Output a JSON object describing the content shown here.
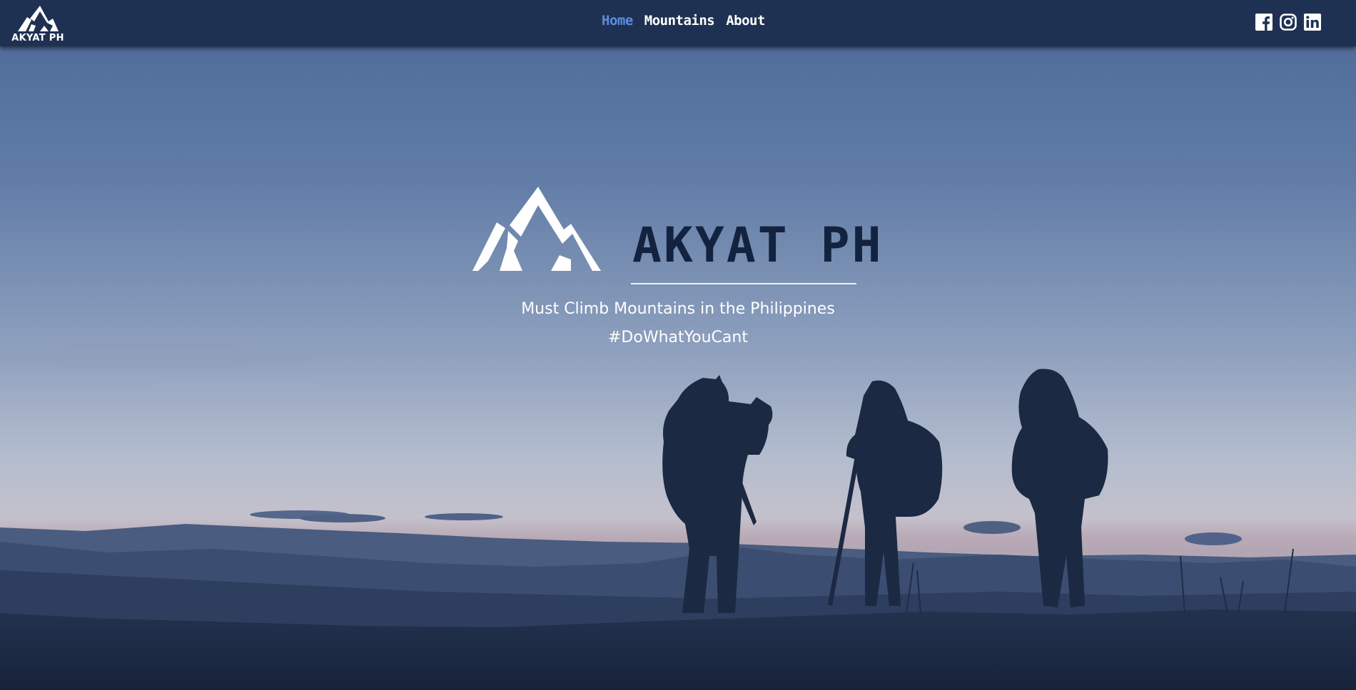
{
  "navbar": {
    "logo_text": "AKYAT PH",
    "links": [
      {
        "label": "Home",
        "active": true
      },
      {
        "label": "Mountains",
        "active": false
      },
      {
        "label": "About",
        "active": false
      }
    ],
    "social": [
      "facebook-icon",
      "instagram-icon",
      "linkedin-icon"
    ],
    "active_color": "#5b8ee0",
    "background": "#1f3153"
  },
  "hero": {
    "brand_title": "AKYAT PH",
    "tagline": "Must Climb Mountains in the Philippines",
    "hashtag": "#DoWhatYouCant",
    "background_image": "hikers-silhouette-at-dusk",
    "title_color": "#13233f"
  }
}
